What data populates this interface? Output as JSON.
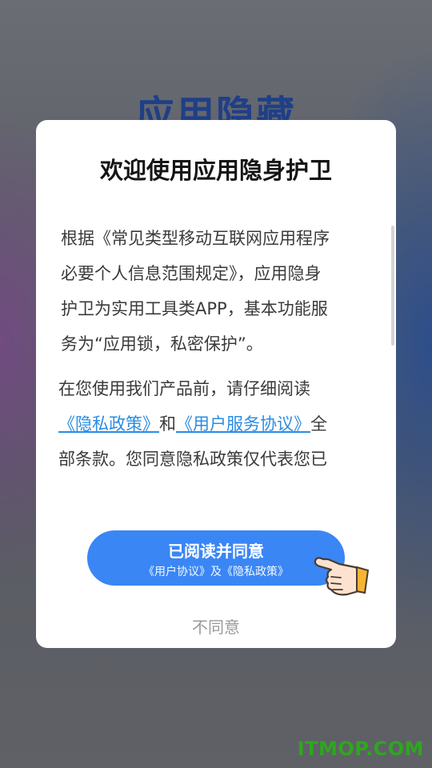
{
  "background": {
    "title": "应用隐藏"
  },
  "dialog": {
    "title": "欢迎使用应用隐身护卫",
    "paragraph1": {
      "lines": [
        "根据《常见类型移动互联网应用程序",
        "必要个人信息范围规定》，应用隐身",
        "护卫为实用工具类APP，基本功能服",
        "务为“应用锁，私密保护”。"
      ]
    },
    "paragraph2": {
      "line1": "在您使用我们产品前，请仔细阅读",
      "privacy_link": "《隐私政策》",
      "and_text": "和",
      "service_link": "《用户服务协议》",
      "after_link": "全",
      "line3": "部条款。您同意隐私政策仅代表您已"
    },
    "agree_button": {
      "label": "已阅读并同意",
      "sublabel": "《用户协议》及《隐私政策》"
    },
    "disagree_label": "不同意"
  },
  "watermark": "ITMOP.COM",
  "colors": {
    "accent": "#3a86f5",
    "link": "#2a8ce3",
    "watermark": "#2ea61f"
  },
  "icons": {
    "hand": "pointing-hand-icon"
  }
}
